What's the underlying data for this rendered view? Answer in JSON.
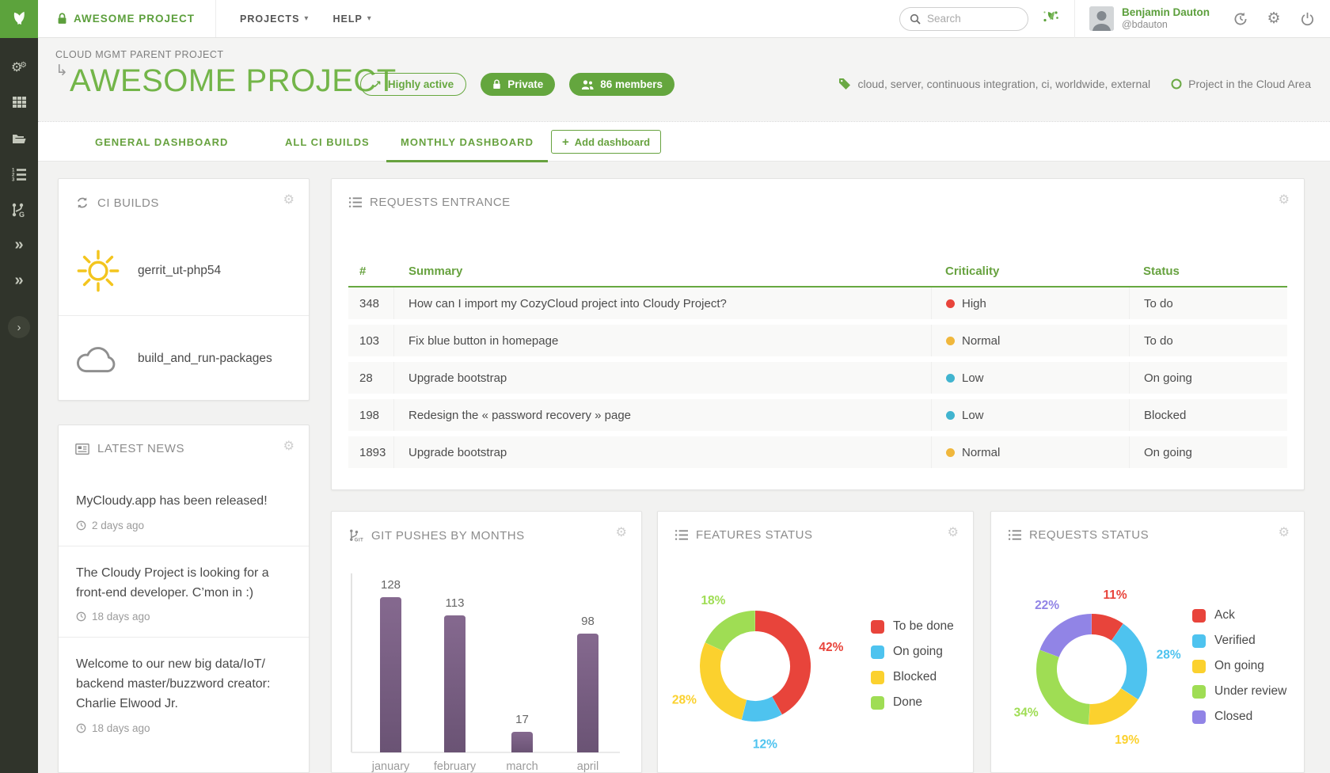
{
  "brand": {
    "accent_green": "#67a23f",
    "sidebar_bg": "#30342b"
  },
  "navbar": {
    "project_label": "AWESOME PROJECT",
    "menus": [
      {
        "label": "PROJECTS"
      },
      {
        "label": "HELP"
      }
    ],
    "search_placeholder": "Search",
    "user": {
      "name": "Benjamin Dauton",
      "handle": "@bdauton"
    }
  },
  "header": {
    "parent_project": "CLOUD MGMT PARENT PROJECT",
    "title": "AWESOME PROJECT",
    "badges": {
      "activity": "Highly active",
      "privacy": "Private",
      "members": "86 members"
    },
    "tags": "cloud, server, continuous integration, ci, worldwide, external",
    "area": "Project in the Cloud Area"
  },
  "tabs": [
    {
      "label": "GENERAL DASHBOARD",
      "active": false
    },
    {
      "label": "ALL CI BUILDS",
      "active": false
    },
    {
      "label": "MONTHLY DASHBOARD",
      "active": true
    }
  ],
  "actions": {
    "add_dashboard": "Add dashboard"
  },
  "widgets": {
    "ci_builds": {
      "title": "CI BUILDS",
      "jobs": [
        {
          "name": "gerrit_ut-php54",
          "status_icon": "sun-icon"
        },
        {
          "name": "build_and_run-packages",
          "status_icon": "cloud-icon"
        }
      ]
    },
    "requests_entrance": {
      "title": "REQUESTS ENTRANCE",
      "columns": [
        "#",
        "Summary",
        "Criticality",
        "Status"
      ],
      "rows": [
        {
          "id": "348",
          "summary": "How can I import my CozyCloud project into Cloudy Project?",
          "criticality": "High",
          "criticality_color": "#e8443b",
          "status": "To do"
        },
        {
          "id": "103",
          "summary": "Fix blue button in homepage",
          "criticality": "Normal",
          "criticality_color": "#f0b73c",
          "status": "To do"
        },
        {
          "id": "28",
          "summary": "Upgrade bootstrap",
          "criticality": "Low",
          "criticality_color": "#41b4cf",
          "status": "On going"
        },
        {
          "id": "198",
          "summary": "Redesign the « password recovery » page",
          "criticality": "Low",
          "criticality_color": "#41b4cf",
          "status": "Blocked"
        },
        {
          "id": "1893",
          "summary": "Upgrade bootstrap",
          "criticality": "Normal",
          "criticality_color": "#f0b73c",
          "status": "On going"
        }
      ]
    },
    "latest_news": {
      "title": "LATEST NEWS",
      "items": [
        {
          "title": "MyCloudy.app has been released!",
          "date": "2 days ago"
        },
        {
          "title": "The Cloudy Project is looking for a front-end developer. C’mon in :)",
          "date": "18 days ago"
        },
        {
          "title": "Welcome to our new big data/IoT/ backend master/buzzword creator: Charlie Elwood Jr.",
          "date": "18 days ago"
        }
      ]
    },
    "git_pushes": {
      "title": "GIT PUSHES BY MONTHS"
    },
    "features_status": {
      "title": "FEATURES STATUS"
    },
    "requests_status": {
      "title": "REQUESTS STATUS"
    }
  },
  "chart_data": [
    {
      "id": "git_pushes",
      "type": "bar",
      "title": "GIT PUSHES BY MONTHS",
      "categories": [
        "january",
        "february",
        "march",
        "april"
      ],
      "values": [
        128,
        113,
        17,
        98
      ],
      "xlabel": "",
      "ylabel": "",
      "ylim": [
        0,
        128
      ],
      "bar_color_top": "#85698f",
      "bar_color_bottom": "#6a5374",
      "grid": false,
      "value_labels": [
        "128",
        "113",
        "17",
        "98"
      ]
    },
    {
      "id": "features_status",
      "type": "pie",
      "title": "FEATURES STATUS",
      "legend_position": "right",
      "series": [
        {
          "label": "To be done",
          "value": 42,
          "color": "#e8443b",
          "pct_label": "42%"
        },
        {
          "label": "On going",
          "value": 12,
          "color": "#4ec3ef",
          "pct_label": "12%"
        },
        {
          "label": "Blocked",
          "value": 28,
          "color": "#fbd12e",
          "pct_label": "28%"
        },
        {
          "label": "Done",
          "value": 18,
          "color": "#9fdd54",
          "pct_label": "18%"
        }
      ]
    },
    {
      "id": "requests_status",
      "type": "pie",
      "title": "REQUESTS STATUS",
      "legend_position": "right",
      "series": [
        {
          "label": "Ack",
          "value": 11,
          "color": "#e8443b",
          "pct_label": "11%"
        },
        {
          "label": "Verified",
          "value": 28,
          "color": "#4ec3ef",
          "pct_label": "28%"
        },
        {
          "label": "On going",
          "value": 19,
          "color": "#fbd12e",
          "pct_label": "19%"
        },
        {
          "label": "Under review",
          "value": 34,
          "color": "#9fdd54",
          "pct_label": "34%"
        },
        {
          "label": "Closed",
          "value": 22,
          "color": "#9184e6",
          "pct_label": "22%"
        }
      ]
    }
  ]
}
